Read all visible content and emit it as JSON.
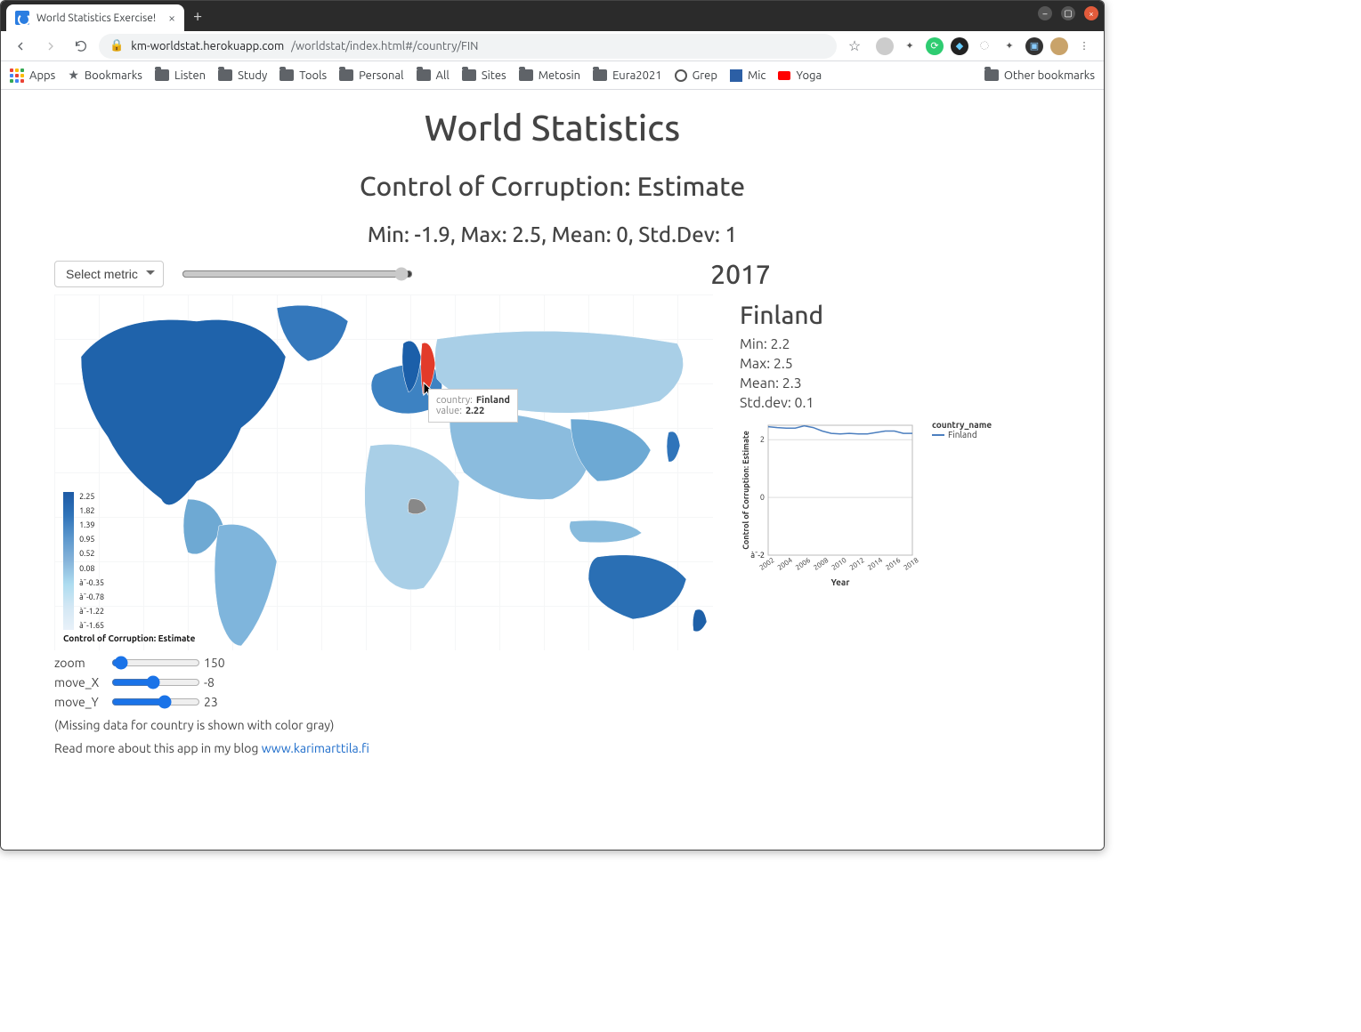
{
  "browser": {
    "tab_title": "World Statistics Exercise!",
    "url_domain": "km-worldstat.herokuapp.com",
    "url_path": "/worldstat/index.html#/country/FIN",
    "bookmarks": [
      "Apps",
      "Bookmarks",
      "Listen",
      "Study",
      "Tools",
      "Personal",
      "All",
      "Sites",
      "Metosin",
      "Eura2021",
      "Grep",
      "Mic",
      "Yoga"
    ],
    "other_bookmarks": "Other bookmarks"
  },
  "page": {
    "title": "World Statistics",
    "metric_title": "Control of Corruption: Estimate",
    "stats_line": "Min: -1.9, Max: 2.5, Mean: 0, Std.Dev: 1",
    "select_label": "Select metric",
    "year": "2017",
    "legend_title": "Control of Corruption: Estimate",
    "legend_ticks": [
      "2.25",
      "1.82",
      "1.39",
      "0.95",
      "0.52",
      "0.08",
      "à¯-0.35",
      "à¯-0.78",
      "à¯-1.22",
      "à¯-1.65"
    ],
    "tooltip": {
      "country_label": "country:",
      "country": "Finland",
      "value_label": "value:",
      "value": "2.22"
    },
    "sliders": {
      "zoom": {
        "label": "zoom",
        "value": "150"
      },
      "move_x": {
        "label": "move_X",
        "value": "-8"
      },
      "move_y": {
        "label": "move_Y",
        "value": "23"
      }
    },
    "missing_note": "(Missing data for country is shown with color gray)",
    "blog_note": "Read more about this app in my blog ",
    "blog_link_text": "www.karimarttila.fi"
  },
  "country_panel": {
    "name": "Finland",
    "min": "Min: 2.2",
    "max": "Max: 2.5",
    "mean": "Mean: 2.3",
    "std": "Std.dev: 0.1",
    "legend_header": "country_name",
    "legend_item": "Finland"
  },
  "chart_data": {
    "type": "line",
    "title": "",
    "xlabel": "Year",
    "ylabel": "Control of Corruption: Estimate",
    "x": [
      2002,
      2003,
      2004,
      2005,
      2006,
      2007,
      2008,
      2009,
      2010,
      2011,
      2012,
      2013,
      2014,
      2015,
      2016,
      2017,
      2018
    ],
    "series": [
      {
        "name": "Finland",
        "values": [
          2.45,
          2.42,
          2.4,
          2.4,
          2.48,
          2.42,
          2.3,
          2.22,
          2.2,
          2.22,
          2.2,
          2.2,
          2.25,
          2.3,
          2.3,
          2.22,
          2.22
        ]
      }
    ],
    "ylim": [
      -2,
      2.5
    ],
    "y_ticks": [
      2,
      0,
      "à¯-2",
      "à¯-2"
    ],
    "x_ticks": [
      2002,
      2004,
      2006,
      2008,
      2010,
      2012,
      2014,
      2016,
      2018
    ]
  }
}
